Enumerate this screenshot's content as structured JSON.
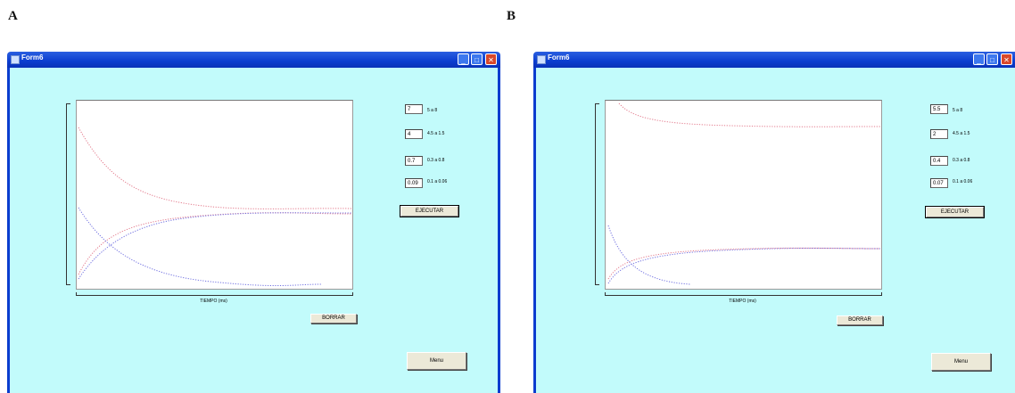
{
  "panels": [
    {
      "letter": "A",
      "window_title": "Form6",
      "inputs": [
        {
          "value": "7",
          "range": "5 a 8"
        },
        {
          "value": "4",
          "range": "4.5 a 1.5"
        },
        {
          "value": "0.7",
          "range": "0.3 a 0.8"
        },
        {
          "value": "0.09",
          "range": "0.1 a 0.06"
        }
      ],
      "execute_label": "EJECUTAR",
      "x_axis_label": "TIEMPO (ms)",
      "clear_label": "BORRAR",
      "menu_label": "Menu"
    },
    {
      "letter": "B",
      "window_title": "Form6",
      "inputs": [
        {
          "value": "5.5",
          "range": "5 a 8"
        },
        {
          "value": "2",
          "range": "4.5 a 1.5"
        },
        {
          "value": "0.4",
          "range": "0.3 a 0.8"
        },
        {
          "value": "0.07",
          "range": "0.1 a 0.06"
        }
      ],
      "execute_label": "EJECUTAR",
      "x_axis_label": "TIEMPO (ms)",
      "clear_label": "BORRAR",
      "menu_label": "Menu"
    }
  ],
  "colors": {
    "client_bg": "#c2fbfb",
    "titlebar": "#0b3dcf",
    "curve_red": "#e37a8c",
    "curve_blue": "#6f6fe0"
  },
  "icons": [
    "window-app-icon",
    "minimize-icon",
    "maximize-icon",
    "close-icon"
  ]
}
